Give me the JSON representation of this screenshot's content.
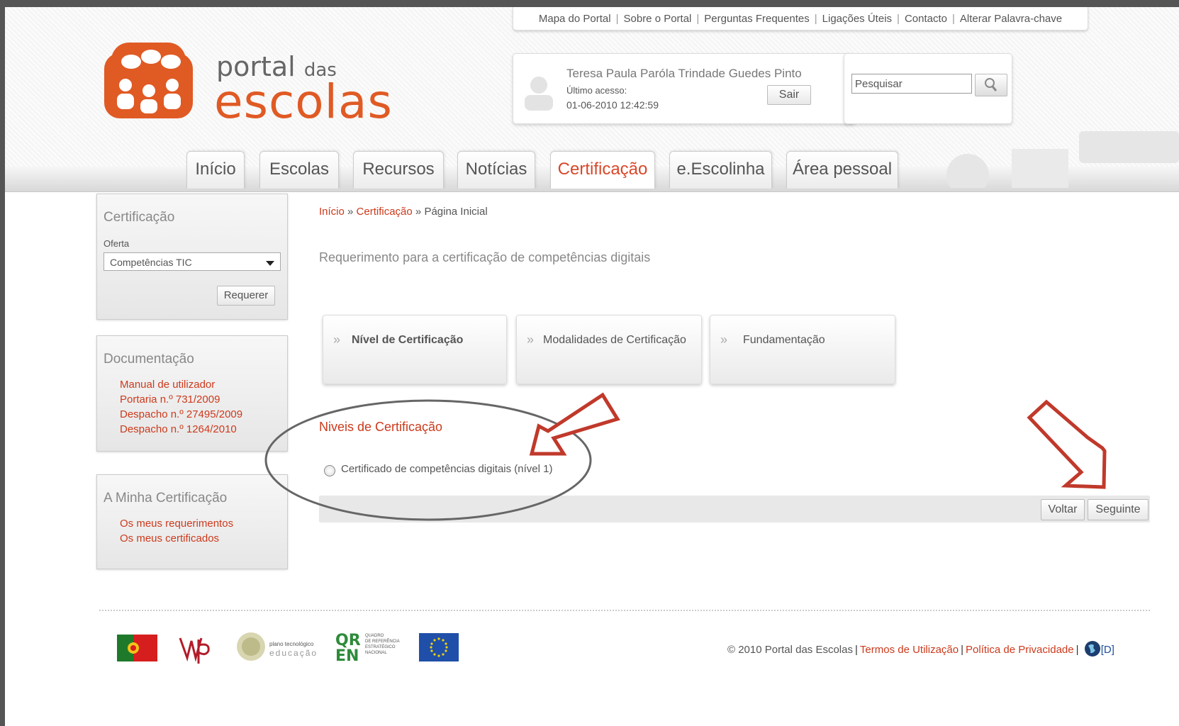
{
  "top_links": [
    "Mapa do Portal",
    "Sobre o Portal",
    "Perguntas Frequentes",
    "Ligações Úteis",
    "Contacto",
    "Alterar Palavra-chave"
  ],
  "logo": {
    "line1": "portal",
    "line1_small": "das",
    "line2": "escolas"
  },
  "user": {
    "name": "Teresa Paula Paróla Trindade Guedes Pinto",
    "last_access_label": "Último acesso:",
    "last_access": "01-06-2010 12:42:59",
    "logout_label": "Sair"
  },
  "search": {
    "placeholder": "Pesquisar",
    "icon": "magnifier-icon"
  },
  "tabs": [
    {
      "label": "Início"
    },
    {
      "label": "Escolas"
    },
    {
      "label": "Recursos"
    },
    {
      "label": "Notícias"
    },
    {
      "label": "Certificação",
      "active": true
    },
    {
      "label": "e.Escolinha"
    },
    {
      "label": "Área pessoal"
    }
  ],
  "sidebar": {
    "certificacao": {
      "title": "Certificação",
      "offer_label": "Oferta",
      "offer_value": "Competências TIC",
      "request_button": "Requerer"
    },
    "documentacao": {
      "title": "Documentação",
      "links": [
        "Manual de utilizador",
        "Portaria n.º 731/2009",
        "Despacho n.º 27495/2009",
        "Despacho n.º 1264/2010"
      ]
    },
    "minha": {
      "title": "A Minha Certificação",
      "links": [
        "Os meus requerimentos",
        "Os meus certificados"
      ]
    }
  },
  "breadcrumb": {
    "home": "Início",
    "sep": "»",
    "section": "Certificação",
    "current": "Página Inicial"
  },
  "main": {
    "title": "Requerimento para a certificação de competências digitais",
    "steps": [
      {
        "label": "Nível de Certificação",
        "active": true
      },
      {
        "label": "Modalidades de Certificação"
      },
      {
        "label": "Fundamentação"
      }
    ],
    "section_title": "Niveis de Certificação",
    "option_label": "Certificado de competências digitais (nível 1)",
    "back_button": "Voltar",
    "next_button": "Seguinte"
  },
  "footer": {
    "logos": [
      "portugal-flag-logo",
      "me-logo",
      "plano-tecnologico-logo",
      "qren-logo",
      "eu-flag-logo"
    ],
    "pte_text": [
      "plano tecnológico",
      "educação"
    ],
    "qren_text": [
      "QUADRO",
      "DE REFERÊNCIA",
      "ESTRATÉGICO",
      "NACIONAL"
    ],
    "copyright": "© 2010 Portal das Escolas",
    "terms": "Termos de Utilização",
    "privacy": "Política de Privacidade",
    "lang": "[D]"
  },
  "colors": {
    "accent": "#cc3a1c",
    "brand": "#e05a24",
    "annotation": "#c0392b"
  }
}
